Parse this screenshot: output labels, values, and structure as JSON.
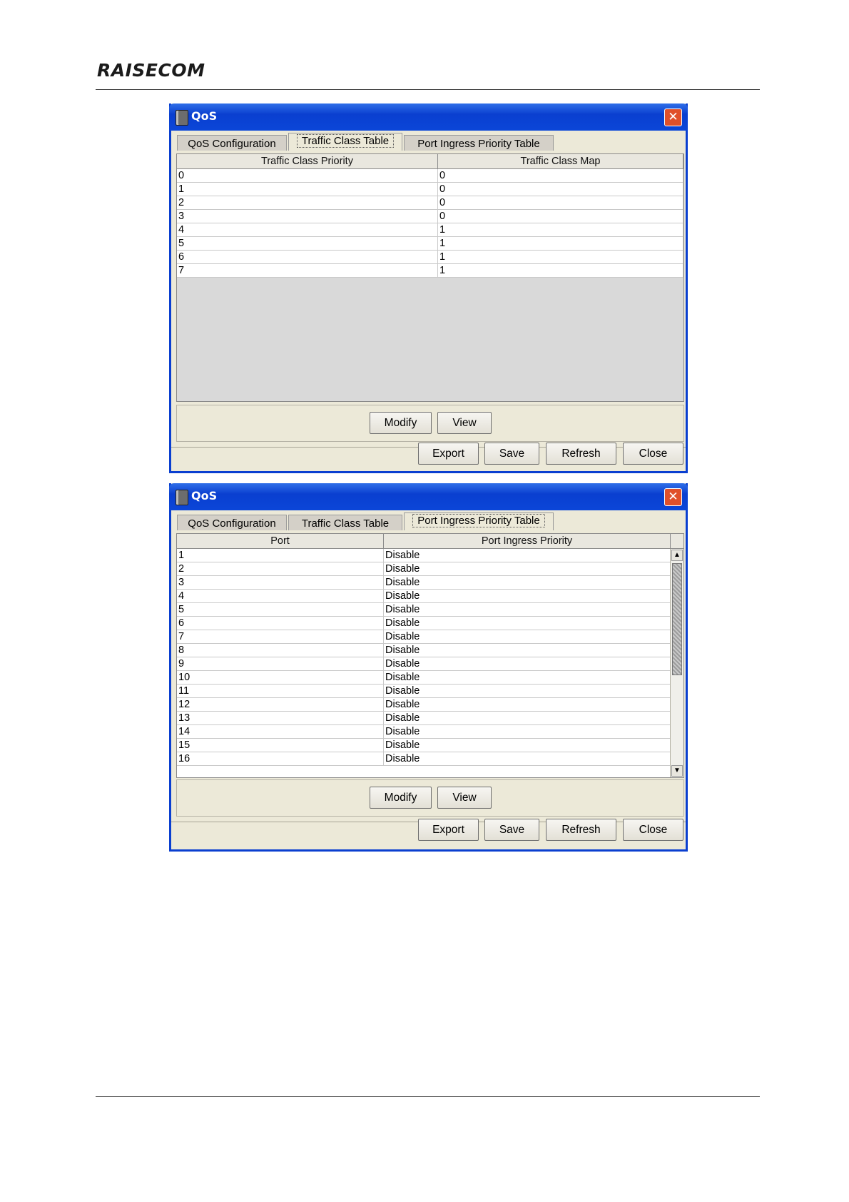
{
  "document": {
    "logo_text": "RAISECOM"
  },
  "window1": {
    "title": "QoS",
    "close_glyph": "✕",
    "tabs": [
      "QoS Configuration",
      "Traffic Class Table",
      "Port Ingress Priority Table"
    ],
    "active_tab": "Traffic Class Table",
    "columns": [
      "Traffic Class Priority",
      "Traffic Class Map"
    ],
    "rows": [
      [
        "0",
        "0"
      ],
      [
        "1",
        "0"
      ],
      [
        "2",
        "0"
      ],
      [
        "3",
        "0"
      ],
      [
        "4",
        "1"
      ],
      [
        "5",
        "1"
      ],
      [
        "6",
        "1"
      ],
      [
        "7",
        "1"
      ]
    ],
    "panel_buttons": {
      "modify": "Modify",
      "view": "View"
    },
    "footer_buttons": {
      "export": "Export",
      "save": "Save",
      "refresh": "Refresh",
      "close": "Close"
    }
  },
  "window2": {
    "title": "QoS",
    "close_glyph": "✕",
    "tabs": [
      "QoS Configuration",
      "Traffic Class Table",
      "Port Ingress Priority Table"
    ],
    "active_tab": "Port Ingress Priority Table",
    "columns": [
      "Port",
      "Port Ingress Priority"
    ],
    "rows": [
      [
        "1",
        "Disable"
      ],
      [
        "2",
        "Disable"
      ],
      [
        "3",
        "Disable"
      ],
      [
        "4",
        "Disable"
      ],
      [
        "5",
        "Disable"
      ],
      [
        "6",
        "Disable"
      ],
      [
        "7",
        "Disable"
      ],
      [
        "8",
        "Disable"
      ],
      [
        "9",
        "Disable"
      ],
      [
        "10",
        "Disable"
      ],
      [
        "11",
        "Disable"
      ],
      [
        "12",
        "Disable"
      ],
      [
        "13",
        "Disable"
      ],
      [
        "14",
        "Disable"
      ],
      [
        "15",
        "Disable"
      ],
      [
        "16",
        "Disable"
      ]
    ],
    "scroll_arrows": {
      "up": "▲",
      "down": "▼"
    },
    "panel_buttons": {
      "modify": "Modify",
      "view": "View"
    },
    "footer_buttons": {
      "export": "Export",
      "save": "Save",
      "refresh": "Refresh",
      "close": "Close"
    }
  }
}
